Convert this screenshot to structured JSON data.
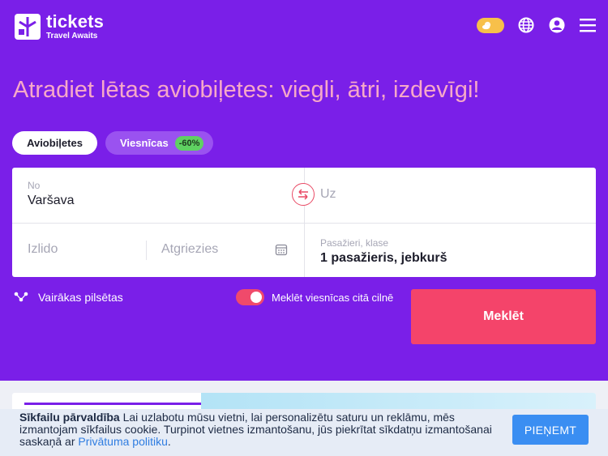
{
  "brand": {
    "name": "tickets",
    "tagline": "Travel Awaits"
  },
  "header": {
    "icons": [
      "theme-toggle-icon",
      "globe-icon",
      "user-icon",
      "menu-icon"
    ]
  },
  "headline": "Atradiet lētas aviobiļetes: viegli, ātri, izdevīgi!",
  "tabs": [
    {
      "label": "Aviobiļetes",
      "active": true
    },
    {
      "label": "Viesnīcas",
      "badge": "-60%",
      "active": false
    }
  ],
  "search": {
    "from_label": "No",
    "from_value": "Varšava",
    "to_placeholder": "Uz",
    "depart_placeholder": "Izlido",
    "return_placeholder": "Atgriezies",
    "pax_label": "Pasažieri, klase",
    "pax_value": "1 pasažieris, jebkurš"
  },
  "options": {
    "multi_city": "Vairākas pilsētas",
    "hotel_search": "Meklēt viesnīcas citā cilnē",
    "hotel_search_on": true
  },
  "search_button": "Meklēt",
  "cookie": {
    "title": "Sīkfailu pārvaldība",
    "body": " Lai uzlabotu mūsu vietni, lai personalizētu saturu un reklāmu, mēs izmantojam sīkfailus cookie. Turpinot vietnes izmantošanu, jūs piekrītat sīkdatņu izmantošanai saskaņā ar ",
    "link": "Privātuma politiku",
    "end": ".",
    "accept": "PIEŅEMT"
  },
  "colors": {
    "hero_bg": "#7a1fe8",
    "headline": "#f7a8c8",
    "accent": "#f4446a",
    "badge": "#5fd162",
    "cookie_button": "#3a8ef2"
  }
}
